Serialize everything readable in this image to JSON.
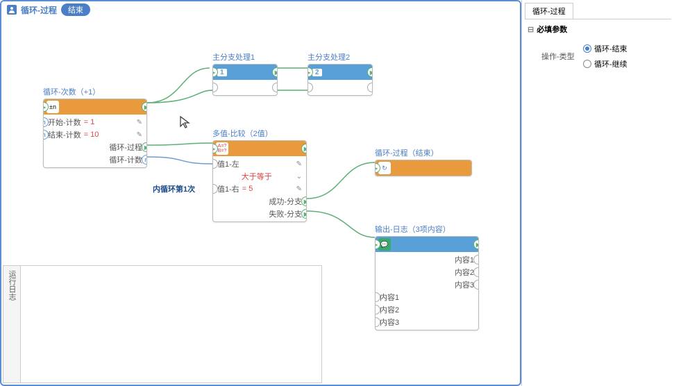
{
  "header": {
    "title": "循环-过程",
    "badge": "结束"
  },
  "nodes": {
    "loop": {
      "title": "循环-次数（+1）",
      "rows": {
        "start_label": "开始-计数",
        "start_val": "= 1",
        "end_label": "结束-计数",
        "end_val": "= 10",
        "proc_label": "循环-过程",
        "count_label": "循环-计数"
      }
    },
    "branch1": {
      "title": "主分支处理1",
      "num": "1"
    },
    "branch2": {
      "title": "主分支处理2",
      "num": "2"
    },
    "compare": {
      "title": "多值-比较（2值）",
      "icon_a": "A=?",
      "icon_b": "B=?",
      "rows": {
        "left": "值1-左",
        "op": "大于等于",
        "right_label": "值1-右",
        "right_val": "= 5",
        "success": "成功-分支",
        "fail": "失败-分支"
      }
    },
    "loopend": {
      "title": "循环-过程（结束）"
    },
    "log": {
      "title": "输出-日志（3项内容）",
      "rows": {
        "c1": "内容1",
        "c2": "内容2",
        "c3": "内容3",
        "l1": "内容1",
        "l2": "内容2",
        "l3": "内容3"
      }
    }
  },
  "inner_label": "内循环第1次",
  "log_panel": {
    "tab": "运行日志"
  },
  "sidebar": {
    "tab": "循环-过程",
    "section": "必填参数",
    "param_label": "操作-类型",
    "options": {
      "end": "循环-结束",
      "continue": "循环-继续"
    }
  }
}
